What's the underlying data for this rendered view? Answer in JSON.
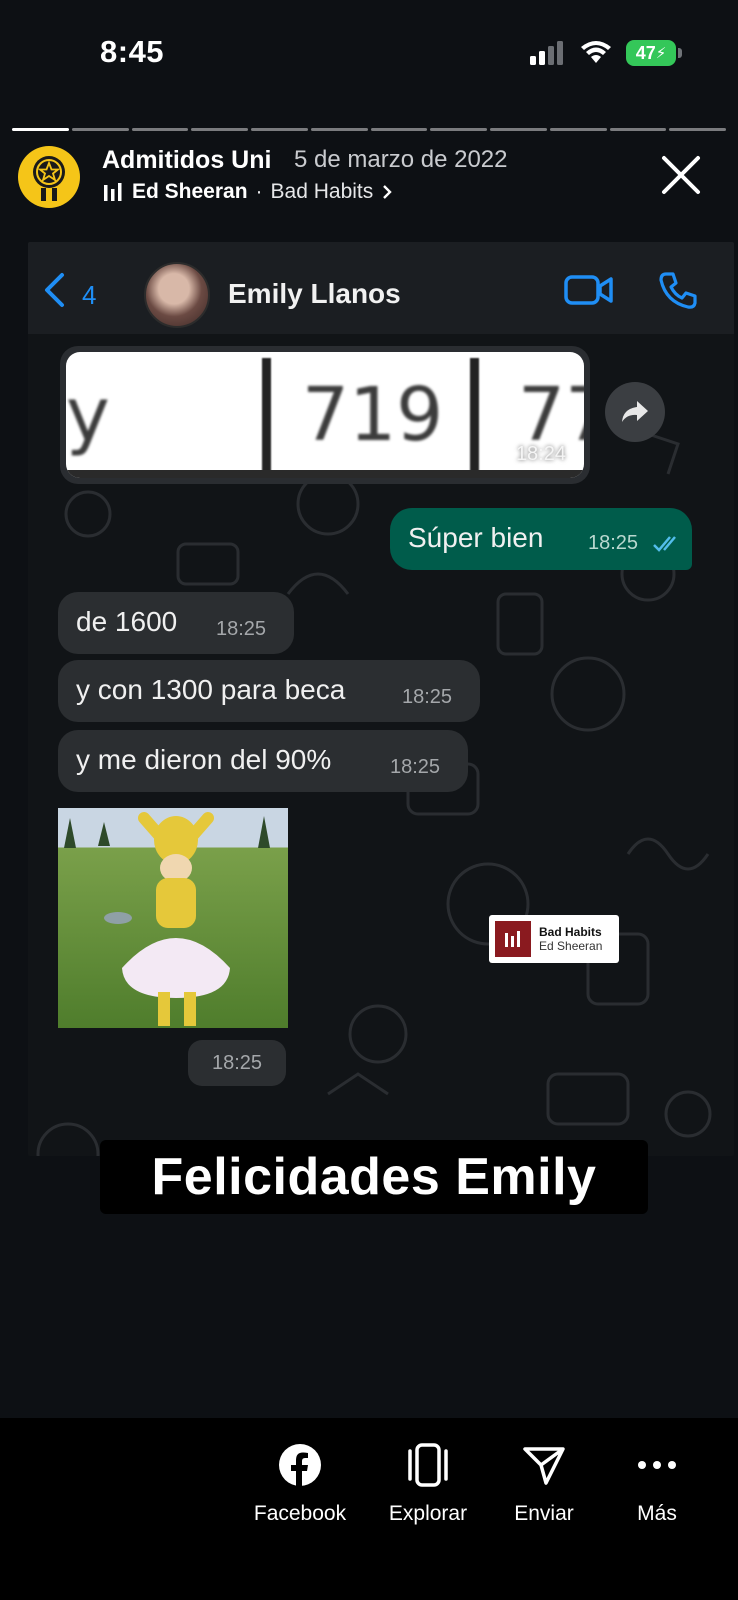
{
  "status_bar": {
    "time": "8:45",
    "battery": "47"
  },
  "story": {
    "account_name": "Admitidos Uni",
    "date": "5 de marzo de 2022",
    "music_artist": "Ed Sheeran",
    "music_separator": "·",
    "music_song": "Bad Habits",
    "progress": {
      "segments_total": 12,
      "segments_done": 1
    }
  },
  "chat": {
    "back_count": "4",
    "contact_name": "Emily Llanos",
    "image_message": {
      "cells": [
        "y",
        "719",
        "77"
      ],
      "time": "18:24"
    },
    "outgoing": [
      {
        "text": "Súper bien",
        "time": "18:25"
      }
    ],
    "incoming": [
      {
        "text": "de 1600",
        "time": "18:25"
      },
      {
        "text": "y con 1300 para beca",
        "time": "18:25"
      },
      {
        "text": "y me dieron del 90%",
        "time": "18:25"
      }
    ],
    "gif_time": "18:25"
  },
  "music_sticker": {
    "title": "Bad Habits",
    "artist": "Ed Sheeran"
  },
  "caption": "Felicidades Emily",
  "actions": [
    {
      "label": "Facebook",
      "icon": "facebook-icon"
    },
    {
      "label": "Explorar",
      "icon": "explore-icon"
    },
    {
      "label": "Enviar",
      "icon": "send-icon"
    },
    {
      "label": "Más",
      "icon": "more-icon"
    }
  ],
  "colors": {
    "outgoing_bubble": "#005c4b",
    "incoming_bubble": "#2b2e31",
    "whatsapp_blue": "#1f8ef5",
    "battery_green": "#34c759",
    "avatar_yellow": "#f5c518"
  }
}
